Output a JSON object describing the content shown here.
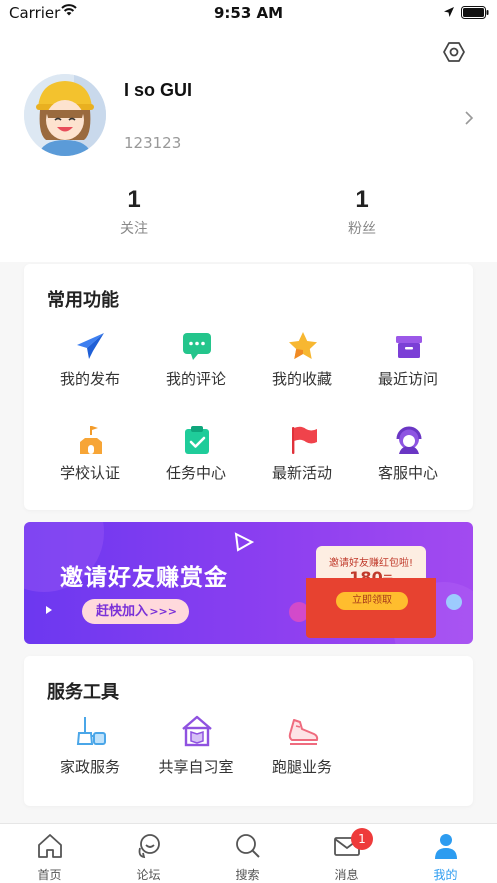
{
  "status_bar": {
    "carrier": "Carrier",
    "time": "9:53 AM"
  },
  "profile": {
    "username": "I so GUI",
    "user_id": "123123"
  },
  "stats": [
    {
      "value": "1",
      "label": "关注"
    },
    {
      "value": "1",
      "label": "粉丝"
    }
  ],
  "functions": {
    "title": "常用功能",
    "items": [
      {
        "label": "我的发布",
        "icon": "send-icon"
      },
      {
        "label": "我的评论",
        "icon": "comment-icon"
      },
      {
        "label": "我的收藏",
        "icon": "star-icon"
      },
      {
        "label": "最近访问",
        "icon": "box-icon"
      },
      {
        "label": "学校认证",
        "icon": "school-icon"
      },
      {
        "label": "任务中心",
        "icon": "clipboard-check-icon"
      },
      {
        "label": "最新活动",
        "icon": "flag-icon"
      },
      {
        "label": "客服中心",
        "icon": "headset-icon"
      }
    ]
  },
  "banner": {
    "headline": "邀请好友赚赏金",
    "button": "赶快加入",
    "button_arrows": ">>>",
    "envelope_text": "邀请好友赚红包啦!",
    "envelope_amount": "180",
    "envelope_unit": "元",
    "claim_button": "立即领取"
  },
  "tools": {
    "title": "服务工具",
    "items": [
      {
        "label": "家政服务",
        "icon": "broom-icon"
      },
      {
        "label": "共享自习室",
        "icon": "house-book-icon"
      },
      {
        "label": "跑腿业务",
        "icon": "sneaker-icon"
      }
    ]
  },
  "tabbar": {
    "items": [
      {
        "label": "首页",
        "icon": "home-icon"
      },
      {
        "label": "论坛",
        "icon": "forum-icon"
      },
      {
        "label": "搜索",
        "icon": "search-icon"
      },
      {
        "label": "消息",
        "icon": "mail-icon",
        "badge": "1"
      },
      {
        "label": "我的",
        "icon": "person-icon",
        "active": true
      }
    ]
  },
  "colors": {
    "accent": "#2d9cf0",
    "badge": "#ee3b3b",
    "banner": "#7a3cf0"
  }
}
